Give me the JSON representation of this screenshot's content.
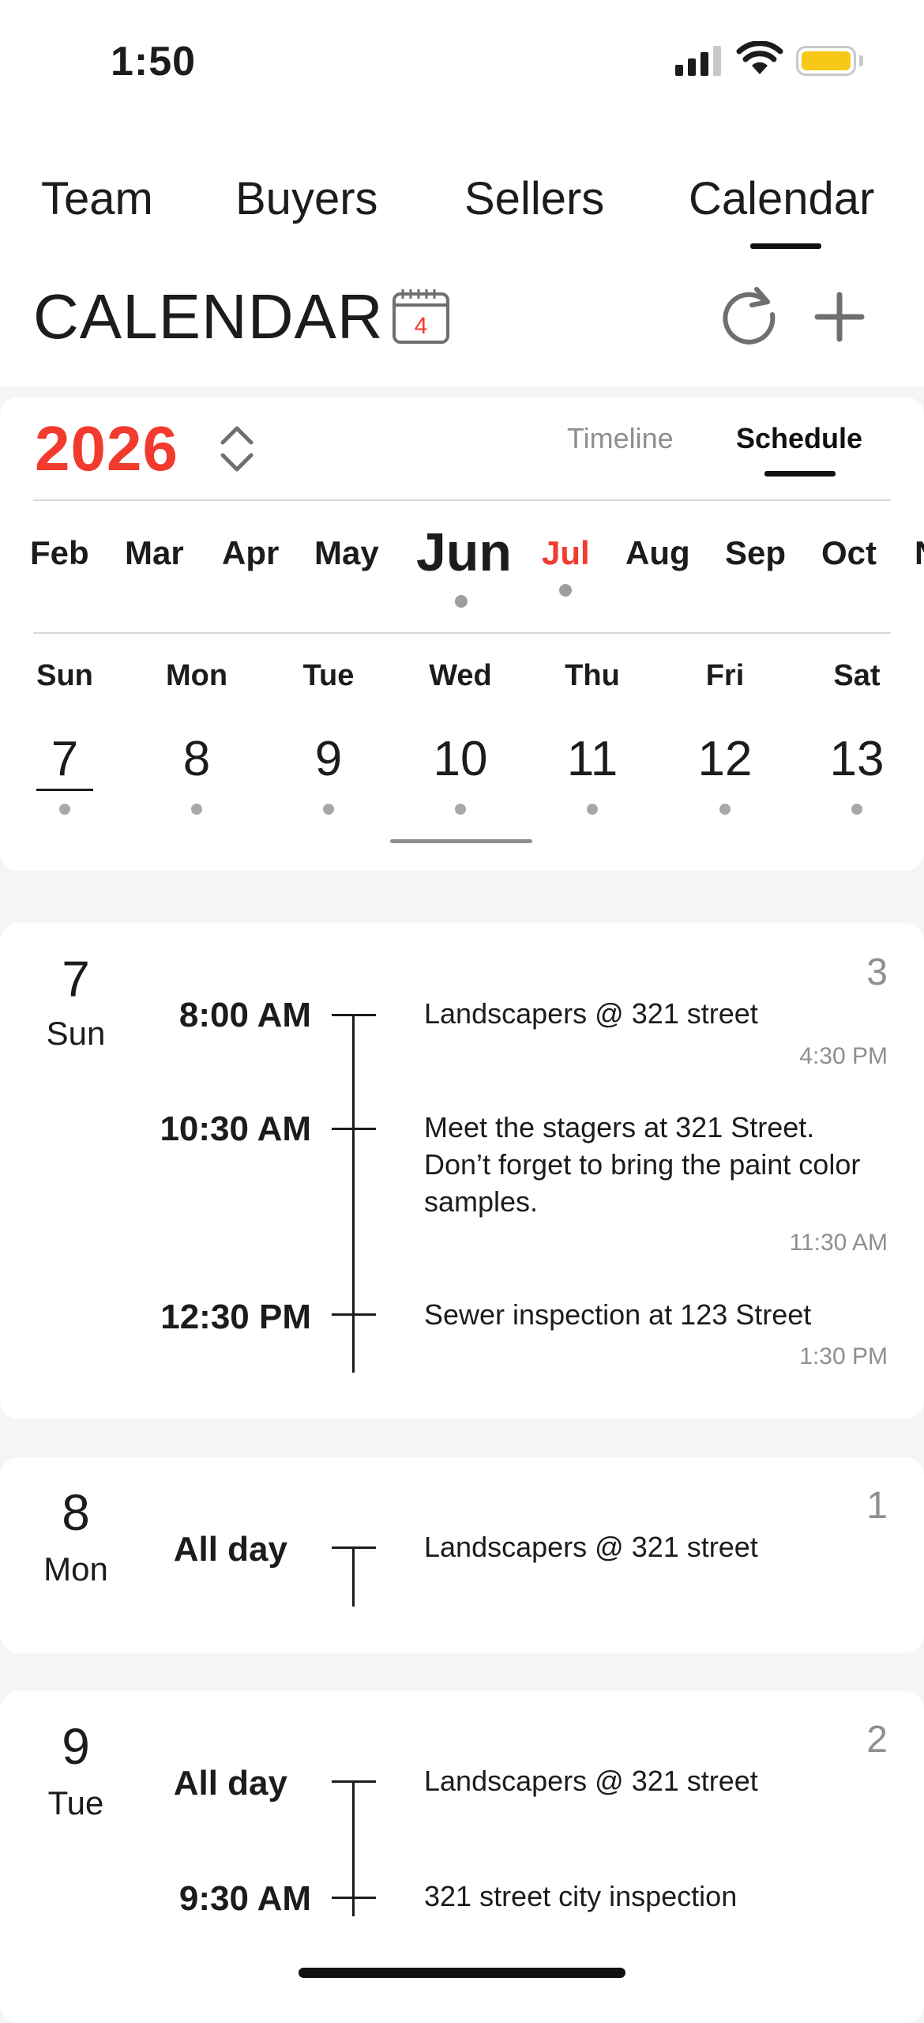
{
  "status_bar": {
    "time": "1:50"
  },
  "nav_tabs": [
    {
      "label": "Team"
    },
    {
      "label": "Buyers"
    },
    {
      "label": "Sellers"
    },
    {
      "label": "Calendar",
      "active": true
    }
  ],
  "header": {
    "title": "CALENDAR",
    "calendar_icon_day": "4"
  },
  "calendar": {
    "year": "2026",
    "views": {
      "timeline": "Timeline",
      "schedule": "Schedule",
      "active": "Schedule"
    },
    "months": [
      "Feb",
      "Mar",
      "Apr",
      "May",
      "Jun",
      "Jul",
      "Aug",
      "Sep",
      "Oct",
      "N"
    ],
    "current_month": "Jun",
    "weekdays": [
      "Sun",
      "Mon",
      "Tue",
      "Wed",
      "Thu",
      "Fri",
      "Sat"
    ],
    "week_dates": [
      "7",
      "8",
      "9",
      "10",
      "11",
      "12",
      "13"
    ],
    "selected_date": "10",
    "today_date": "7"
  },
  "schedule": [
    {
      "day": "7",
      "weekday": "Sun",
      "count": "3",
      "events": [
        {
          "start": "8:00 AM",
          "title": "Landscapers @ 321 street",
          "end": "4:30 PM"
        },
        {
          "start": "10:30 AM",
          "title": "Meet the stagers at 321 Street. Don’t forget to bring the paint color samples.",
          "end": "11:30 AM"
        },
        {
          "start": "12:30 PM",
          "title": "Sewer inspection at 123 Street",
          "end": "1:30 PM"
        }
      ]
    },
    {
      "day": "8",
      "weekday": "Mon",
      "count": "1",
      "events": [
        {
          "start": "All day",
          "title": "Landscapers @ 321 street"
        }
      ]
    },
    {
      "day": "9",
      "weekday": "Tue",
      "count": "2",
      "events": [
        {
          "start": "All day",
          "title": "Landscapers @ 321 street"
        },
        {
          "start": "9:30 AM",
          "title": "321 street city inspection"
        }
      ]
    }
  ],
  "colors": {
    "accent_red": "#f23a2e",
    "battery": "#f8c818",
    "muted": "#8e8e93"
  }
}
